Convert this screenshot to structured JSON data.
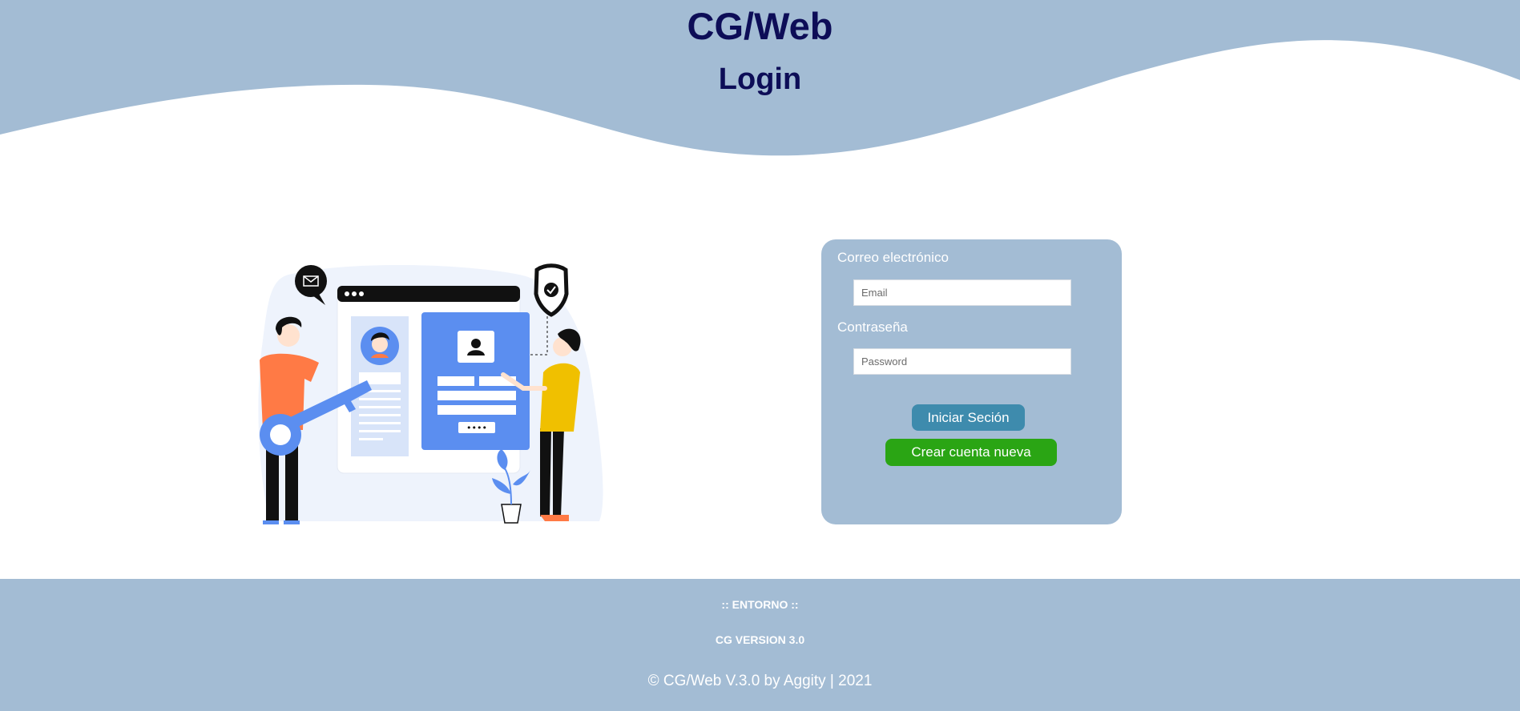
{
  "header": {
    "app_title": "CG/Web",
    "page_title": "Login",
    "wave_color": "#a3bcd4"
  },
  "illustration": {
    "icons": [
      "mail-icon",
      "shield-check-icon",
      "user-icon",
      "key-icon",
      "plant-icon"
    ],
    "password_dots": "••••"
  },
  "login_form": {
    "email_label": "Correo electrónico",
    "email_placeholder": "Email",
    "password_label": "Contraseña",
    "password_placeholder": "Password",
    "login_button": "Iniciar Seción",
    "create_account_button": "Crear cuenta nueva",
    "card_color": "#a3bcd4",
    "login_button_color": "#3e8bad",
    "create_button_color": "#2aa514"
  },
  "footer": {
    "environment": ":: ENTORNO ::",
    "version": "CG VERSION 3.0",
    "copyright": "© CG/Web V.3.0 by Aggity | 2021"
  }
}
